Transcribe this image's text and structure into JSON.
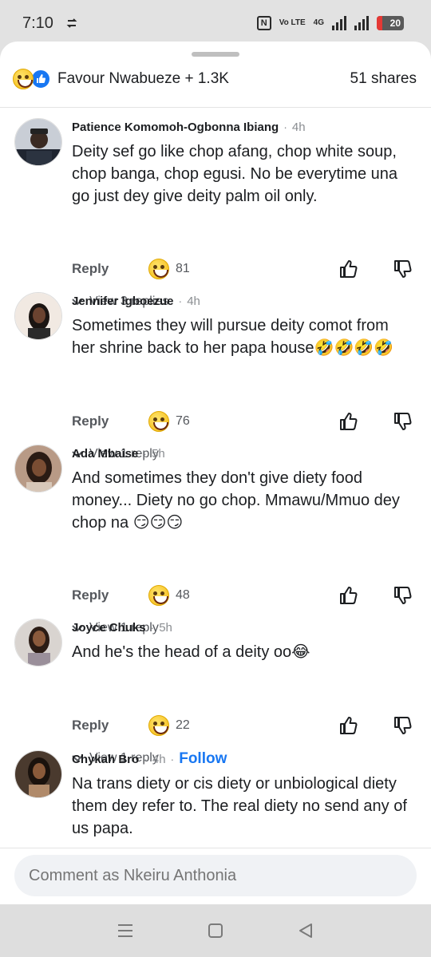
{
  "status_bar": {
    "time": "7:10",
    "sync_icon": "sync-icon",
    "nfc_label": "N",
    "volte_label": "Vo LTE",
    "network": "4G",
    "battery": "20",
    "battery_level": 0.2
  },
  "header": {
    "reactions_text": "Favour Nwabueze + 1.3K",
    "shares_text": "51 shares"
  },
  "comments": [
    {
      "name": "Patience Komomoh-Ogbonna Ibiang",
      "time": "4h",
      "text": "Deity sef go like chop afang, chop white soup, chop banga, chop egusi. No be everytime una go just dey give deity palm oil only.",
      "reply_label": "Reply",
      "reaction_count": "81",
      "view_replies": "View 3 replies"
    },
    {
      "name": "Jennifer Igboezue",
      "time": "4h",
      "text": "Sometimes they  will pursue deity comot from her shrine back to her papa house🤣🤣🤣🤣",
      "reply_label": "Reply",
      "reaction_count": "76",
      "view_replies": "View 1 reply"
    },
    {
      "name": "Ada Mbaise",
      "time": "5h",
      "text": "And sometimes they don't give diety food money... Diety no go chop. Mmawu/Mmuo dey chop na 😏😏😏",
      "reply_label": "Reply",
      "reaction_count": "48",
      "view_replies": "View 1 reply"
    },
    {
      "name": "Joyce Chuks",
      "time": "5h",
      "text": "And he's the head of a deity oo😂",
      "reply_label": "Reply",
      "reaction_count": "22",
      "view_replies": "View 1 reply"
    },
    {
      "name": "Chykah Bro",
      "time": "4h",
      "follow_label": "Follow",
      "text": "Na trans diety or cis diety or unbiological diety them dey refer to. The real diety no send any of us papa."
    }
  ],
  "composer": {
    "placeholder": "Comment as Nkeiru Anthonia"
  },
  "colors": {
    "accent": "#1877f2",
    "sheet_bg": "#ffffff",
    "chrome_bg": "#e2e2e2"
  }
}
